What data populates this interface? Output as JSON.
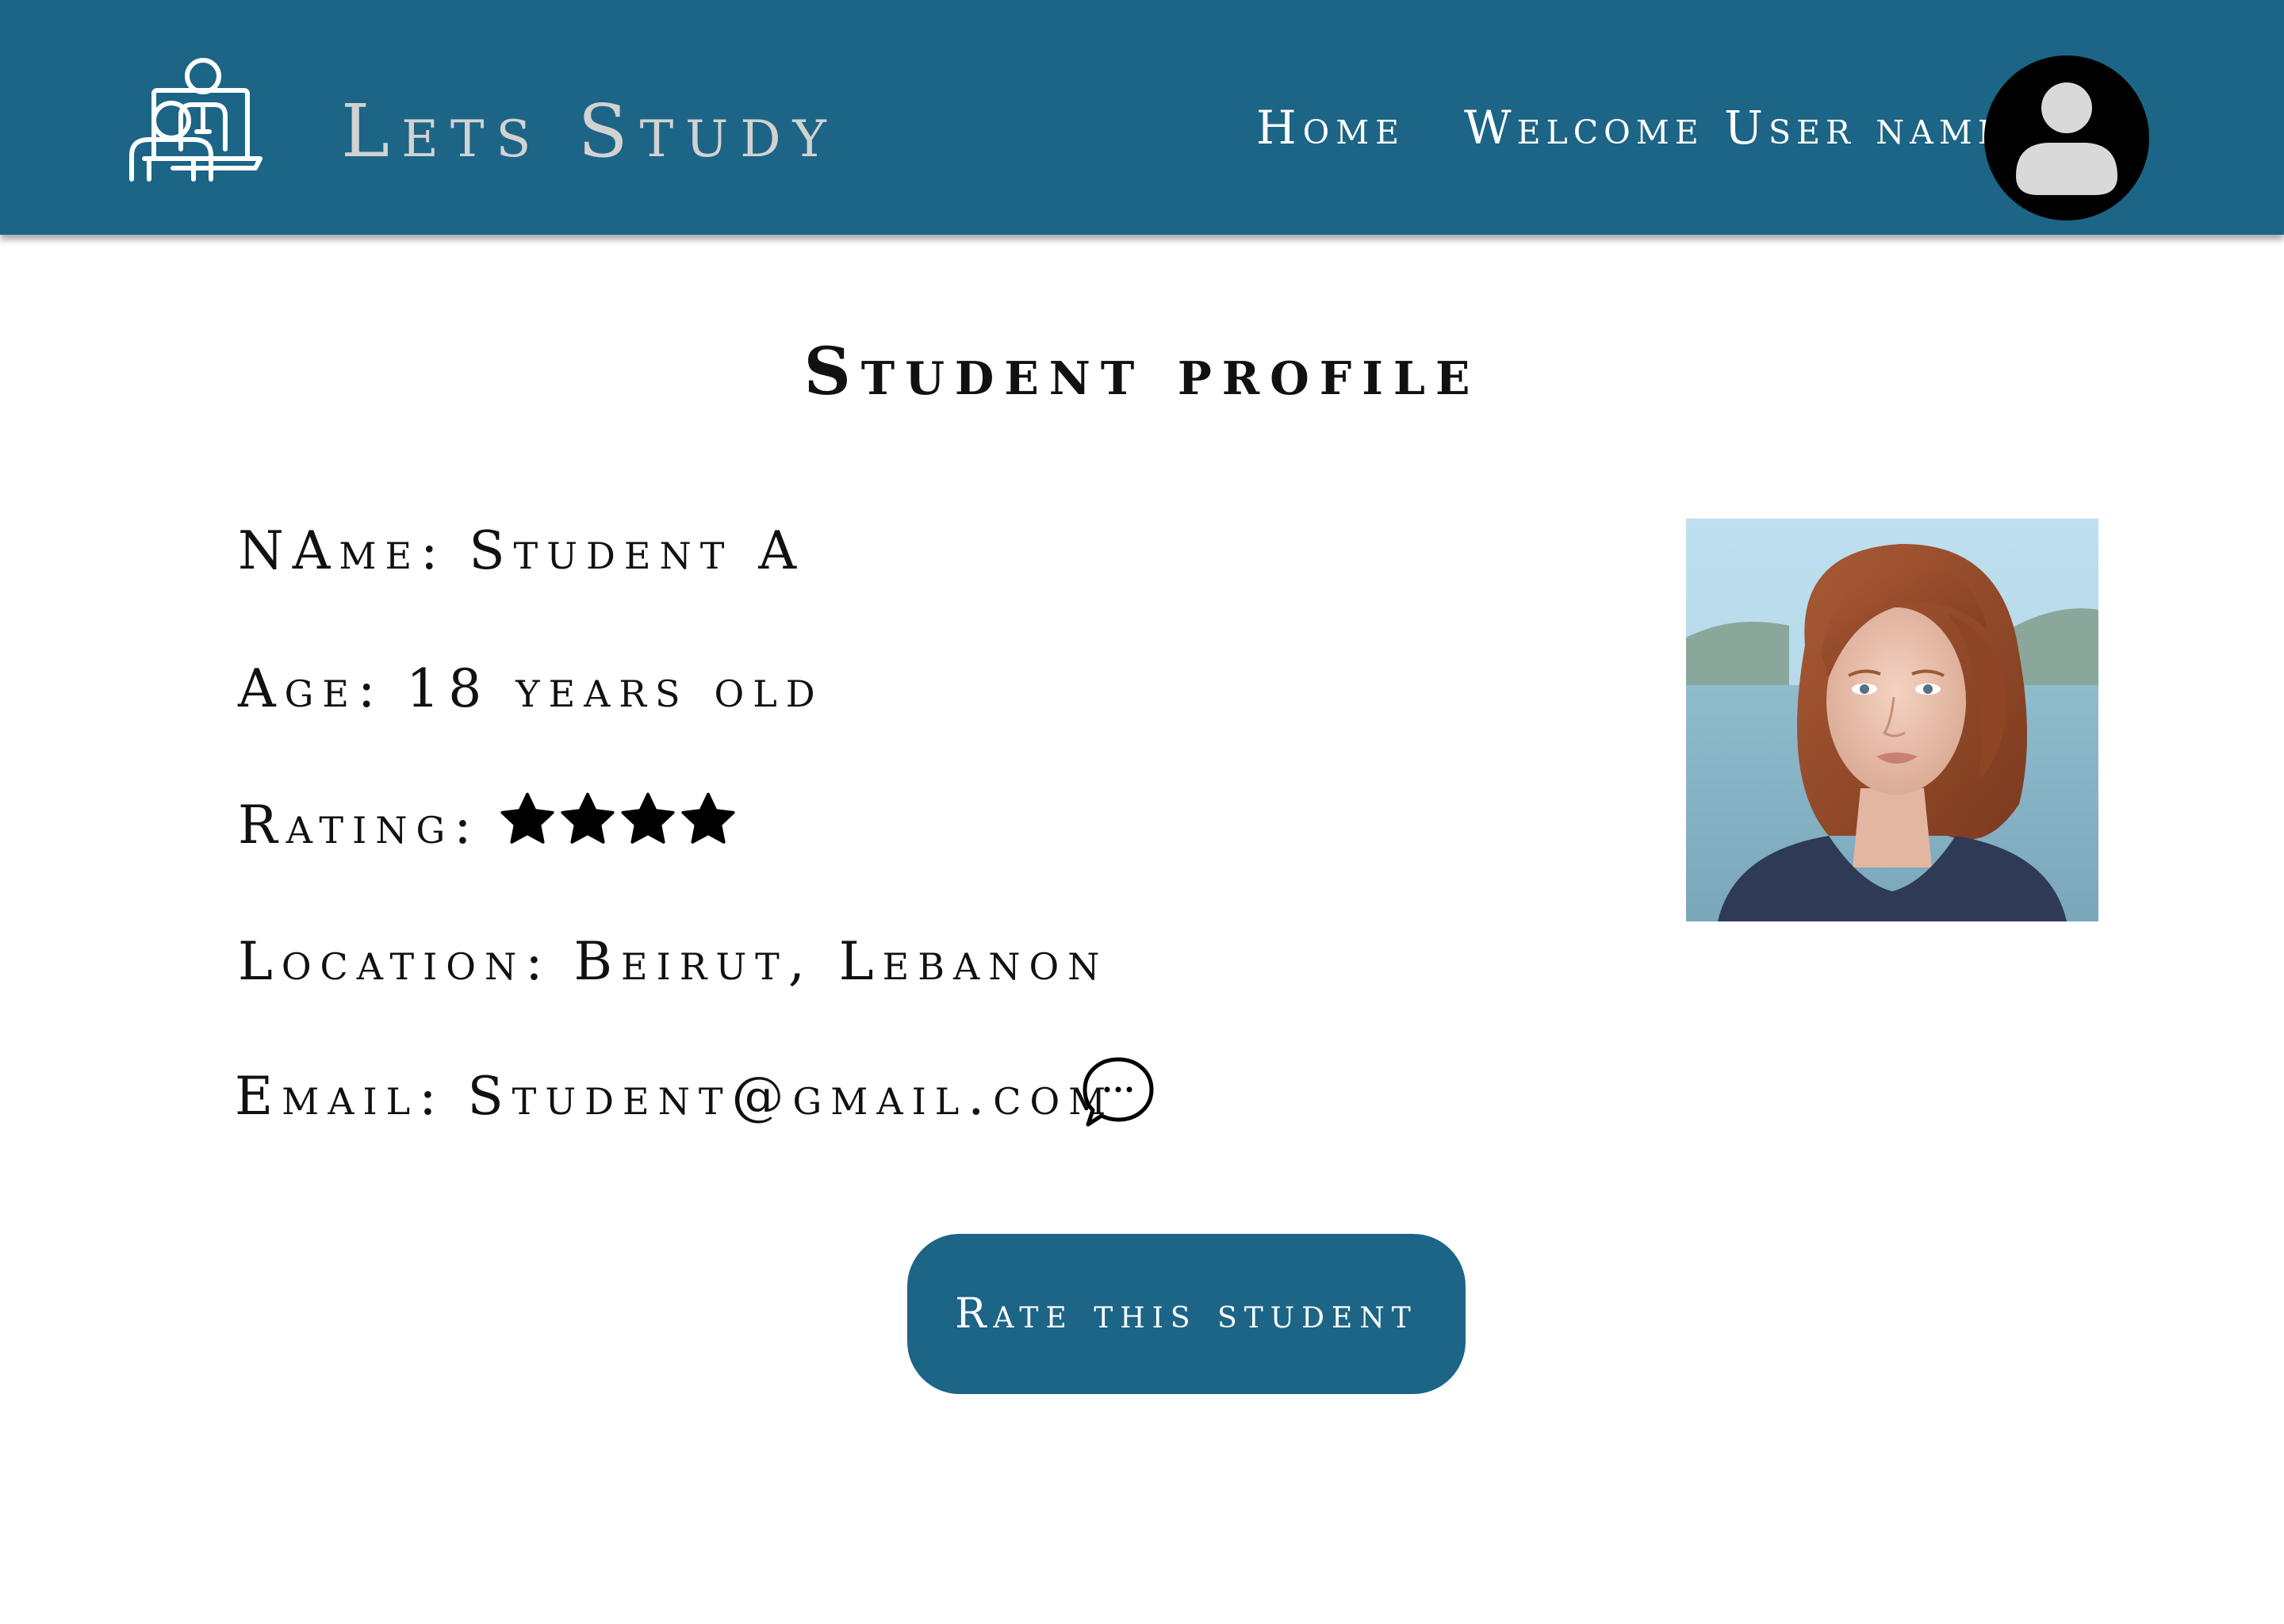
{
  "header": {
    "brand": "Lets Study",
    "nav_home": "Home",
    "nav_welcome": "Welcome User name",
    "logo_icon": "teacher-laptop-icon",
    "avatar_icon": "user-avatar-icon"
  },
  "profile": {
    "title": "Student profile",
    "name_label": "NAme:",
    "name_value": "Student A",
    "age_label": "Age:",
    "age_value": "18 years old",
    "rating_label": "Rating:",
    "rating_value": 4,
    "rating_max": 4,
    "location_label": "Location:",
    "location_value": "Beirut, Lebanon",
    "email_label": "Email:",
    "email_value": "Student@gmail.com",
    "chat_icon": "chat-bubble-icon",
    "photo": "student-portrait-photo"
  },
  "actions": {
    "rate_button": "Rate this student"
  },
  "colors": {
    "primary": "#1c6586",
    "brand_text": "#d2d2d2",
    "text": "#111111",
    "background": "#ffffff"
  }
}
